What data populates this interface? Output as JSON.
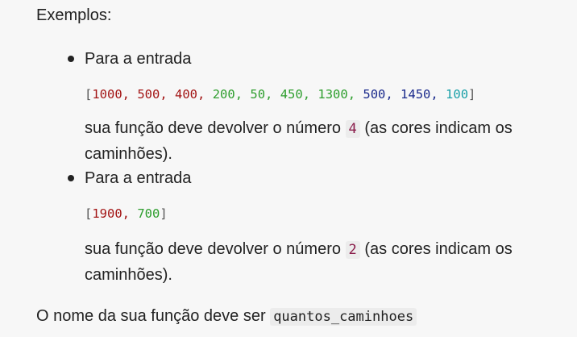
{
  "heading": "Exemplos:",
  "examples": [
    {
      "bullet": "Para a entrada",
      "array_values": [
        {
          "text": "1000",
          "color": "#a31515"
        },
        {
          "text": "500",
          "color": "#a31515"
        },
        {
          "text": "400",
          "color": "#a31515"
        },
        {
          "text": "200",
          "color": "#2e9e2e"
        },
        {
          "text": "50",
          "color": "#2e9e2e"
        },
        {
          "text": "450",
          "color": "#2e9e2e"
        },
        {
          "text": "1300",
          "color": "#2e9e2e"
        },
        {
          "text": "500",
          "color": "#1a2a8c"
        },
        {
          "text": "1450",
          "color": "#1a2a8c"
        },
        {
          "text": "100",
          "color": "#1aa0a8"
        }
      ],
      "result_before": "sua função deve devolver o número",
      "result_number": "4",
      "result_after": "(as cores indicam os caminhões)."
    },
    {
      "bullet": "Para a entrada",
      "array_values": [
        {
          "text": "1900",
          "color": "#a31515"
        },
        {
          "text": "700",
          "color": "#2e9e2e"
        }
      ],
      "result_before": "sua função deve devolver o número",
      "result_number": "2",
      "result_after": "(as cores indicam os caminhões)."
    }
  ],
  "footer": {
    "text": "O nome da sua função deve ser",
    "function_name": "quantos_caminhoes"
  },
  "syntax": {
    "open_bracket": "[",
    "close_bracket": "]",
    "separator": ", "
  }
}
